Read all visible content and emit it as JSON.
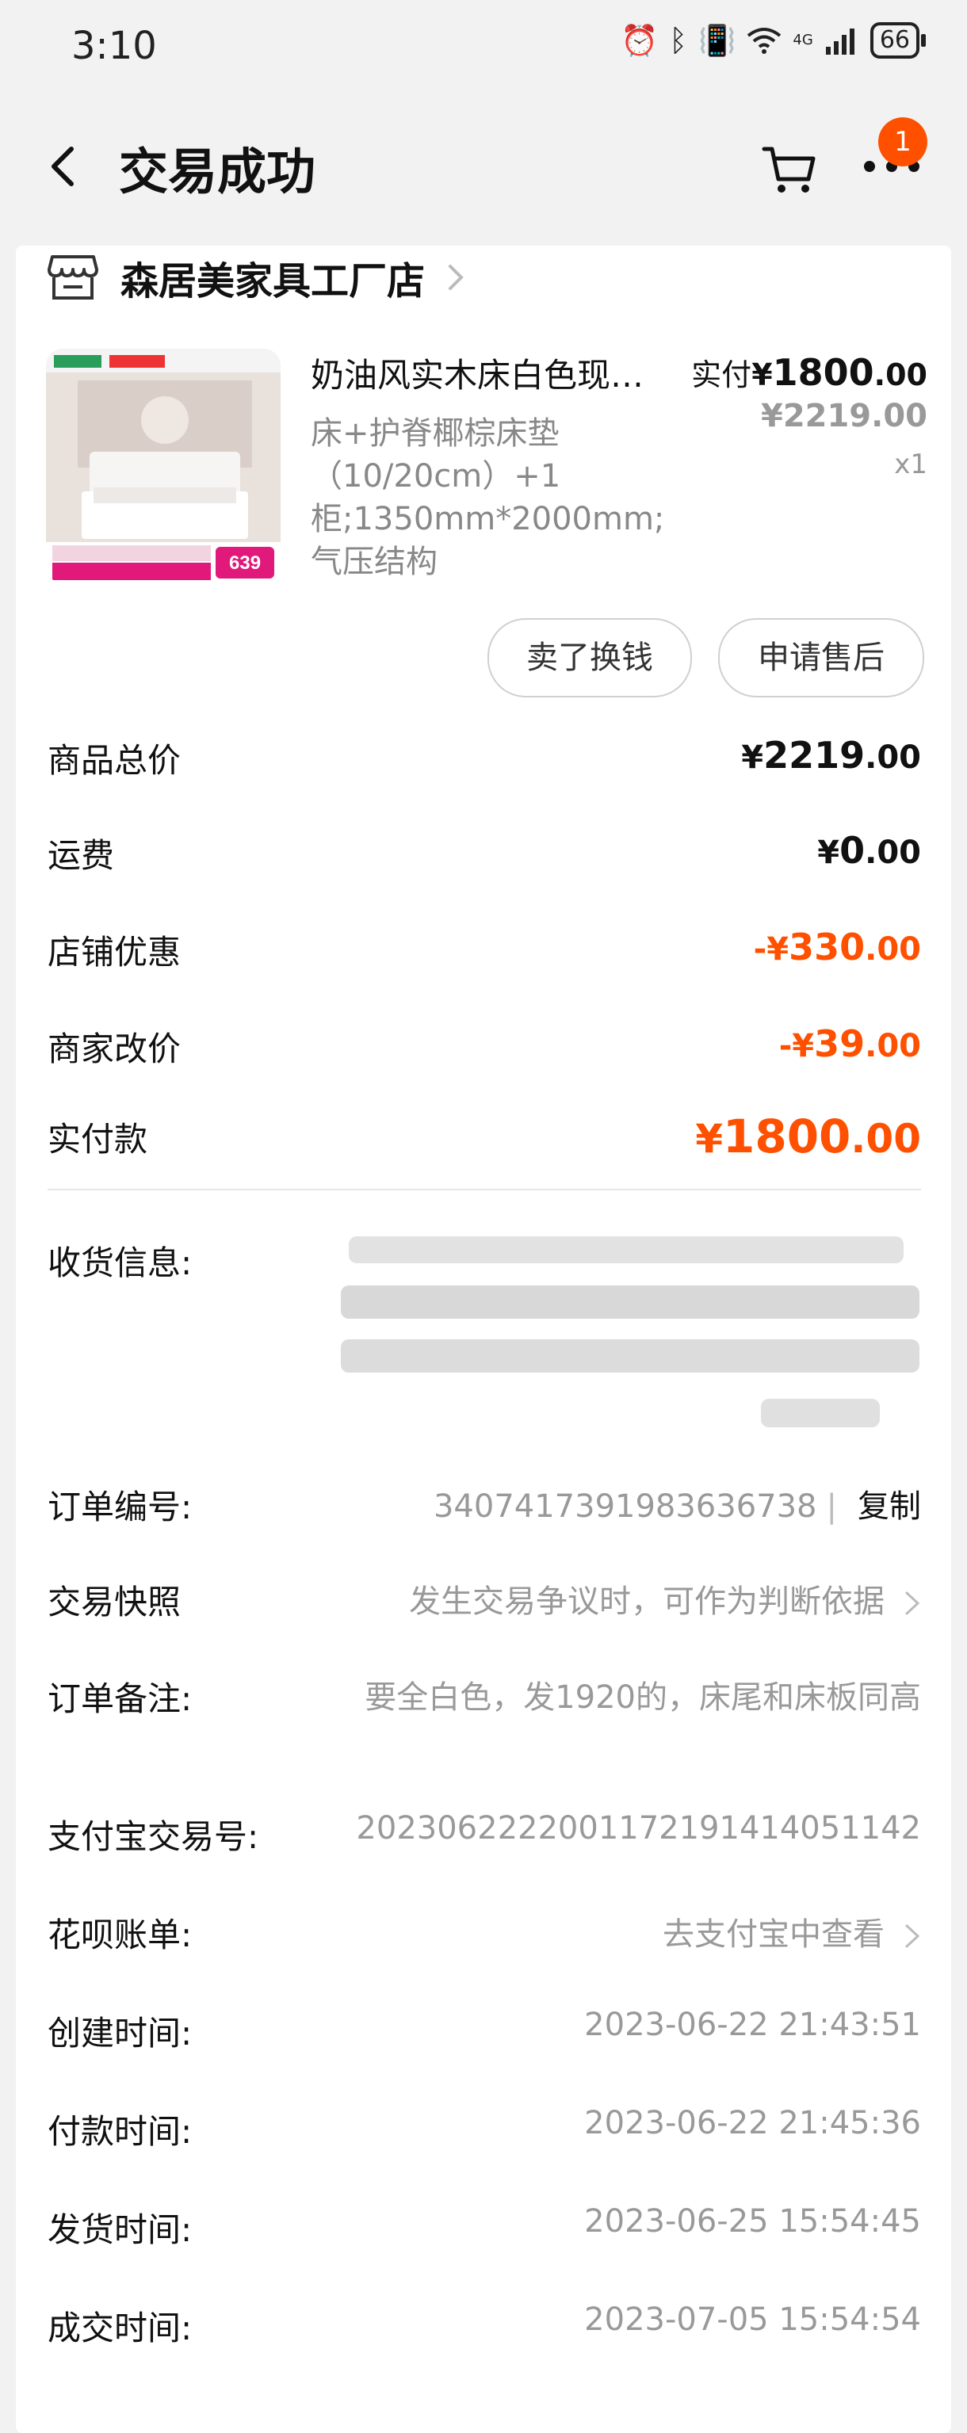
{
  "status_bar": {
    "time": "3:10",
    "network": "4G",
    "battery": "66"
  },
  "header": {
    "title": "交易成功",
    "notification_count": "1"
  },
  "shop": {
    "name": "森居美家具工厂店"
  },
  "product": {
    "title": "奶油风实木床白色现…",
    "spec": "床+护脊椰棕床垫（10/20cm）+1柜;1350mm*2000mm;气压结构",
    "paid_label": "实付",
    "paid_currency": "¥",
    "paid_int": "1800",
    "paid_dec": ".00",
    "orig_currency": "¥",
    "orig_int": "2219",
    "orig_dec": ".00",
    "qty": "x1",
    "image_price": "639"
  },
  "actions": {
    "sell_label": "卖了换钱",
    "after_sale_label": "申请售后"
  },
  "summary": {
    "goods_total": {
      "label": "商品总价",
      "prefix": "¥",
      "int": "2219",
      "dec": ".00"
    },
    "shipping": {
      "label": "运费",
      "prefix": "¥",
      "int": "0",
      "dec": ".00"
    },
    "shop_discount": {
      "label": "店铺优惠",
      "prefix": "-¥",
      "int": "330",
      "dec": ".00"
    },
    "merchant_adjust": {
      "label": "商家改价",
      "prefix": "-¥",
      "int": "39",
      "dec": ".00"
    },
    "paid_total": {
      "label": "实付款",
      "prefix": "¥",
      "int": "1800",
      "dec": ".00"
    }
  },
  "details": {
    "receiver": {
      "label": "收货信息:"
    },
    "order_no": {
      "label": "订单编号:",
      "value": "3407417391983636738",
      "copy_label": "复制"
    },
    "snapshot": {
      "label": "交易快照",
      "value": "发生交易争议时，可作为判断依据"
    },
    "remark": {
      "label": "订单备注:",
      "value": "要全白色，发1920的，床尾和床板同高"
    },
    "alipay_no": {
      "label": "支付宝交易号:",
      "value": "2023062222001172191414051142"
    },
    "huabei": {
      "label": "花呗账单:",
      "value": "去支付宝中查看"
    },
    "created": {
      "label": "创建时间:",
      "value": "2023-06-22 21:43:51"
    },
    "paid_time": {
      "label": "付款时间:",
      "value": "2023-06-22 21:45:36"
    },
    "shipped": {
      "label": "发货时间:",
      "value": "2023-06-25 15:54:45"
    },
    "closed": {
      "label": "成交时间:",
      "value": "2023-07-05 15:54:54"
    }
  },
  "colors": {
    "accent": "#ff5000",
    "muted": "#999999"
  }
}
